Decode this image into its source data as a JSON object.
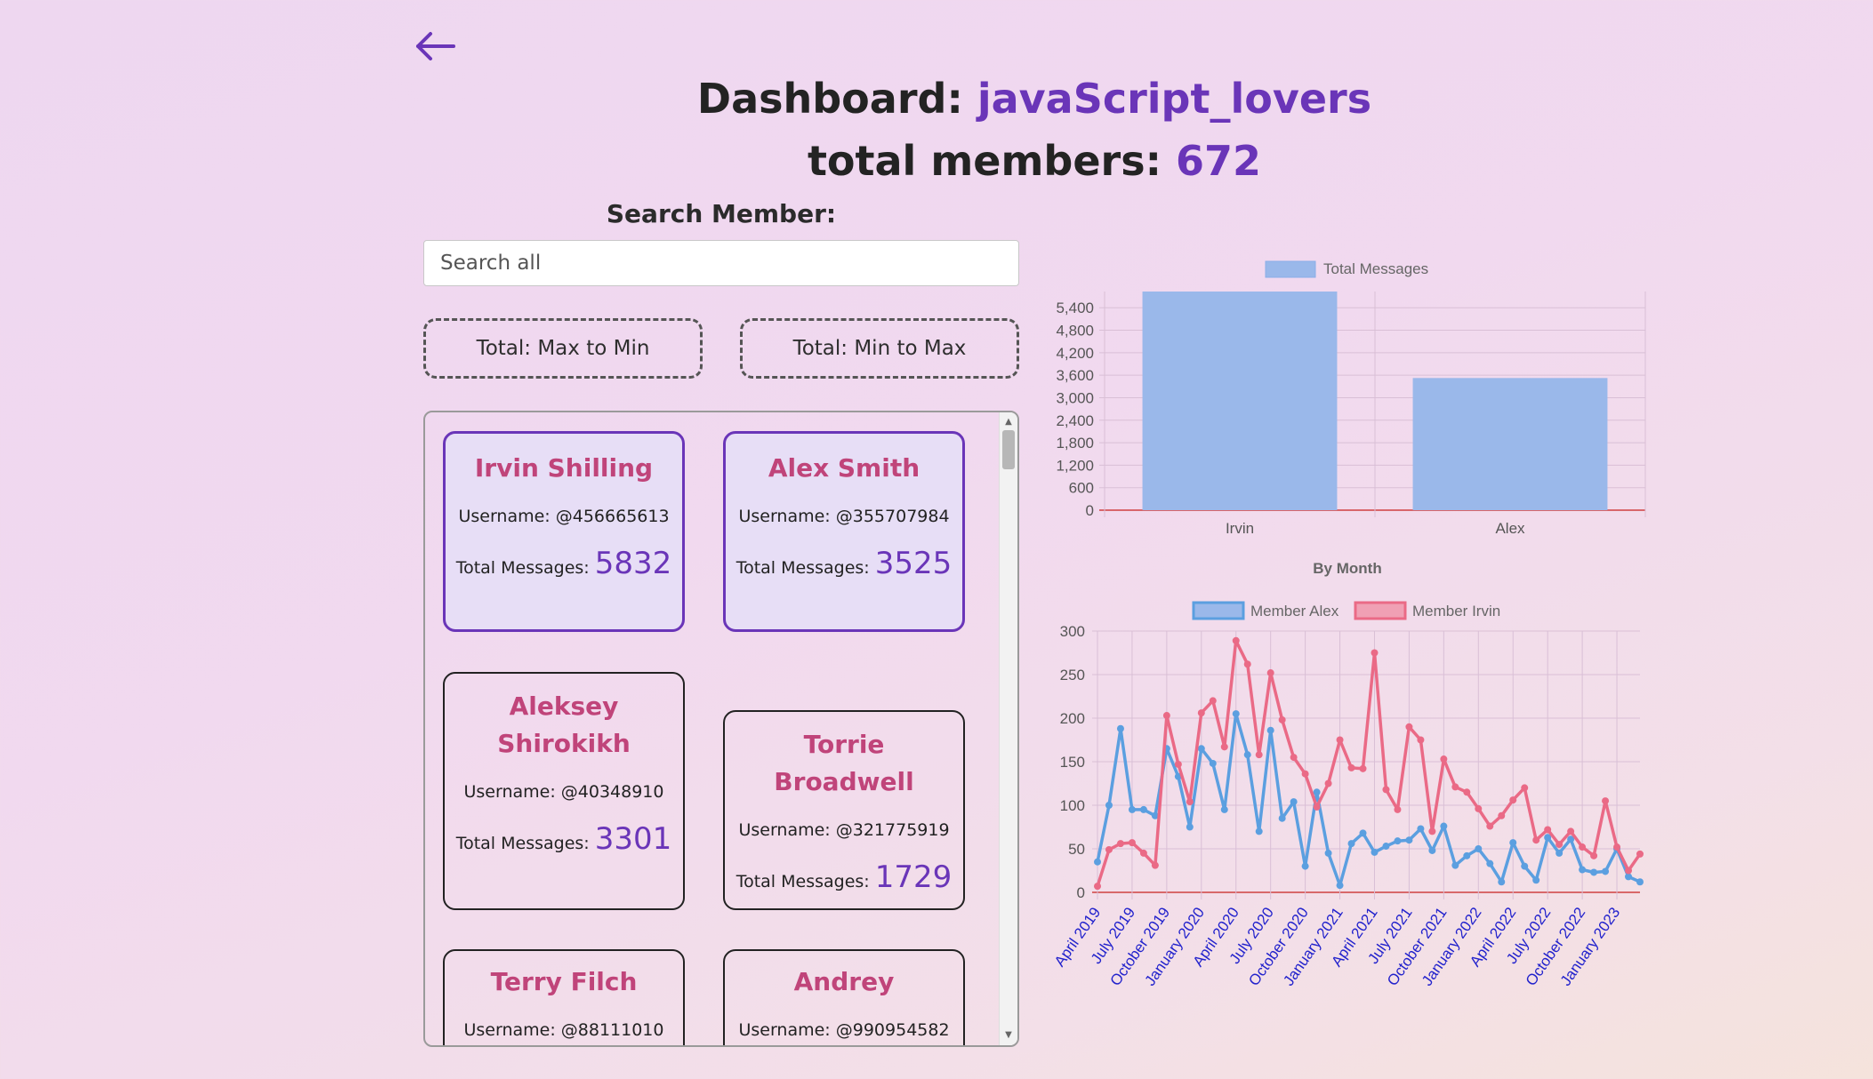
{
  "header": {
    "dashboard_prefix": "Dashboard:",
    "group_name": "javaScript_lovers",
    "members_prefix": "total members:",
    "members_count": "672"
  },
  "search": {
    "label": "Search Member:",
    "placeholder": "Search all",
    "value": ""
  },
  "sort": {
    "max_to_min": "Total: Max to Min",
    "min_to_max": "Total: Min to Max"
  },
  "members": [
    {
      "name": "Irvin Shilling",
      "username": "Username: @456665613",
      "total_label": "Total Messages:",
      "total": "5832",
      "selected": true
    },
    {
      "name": "Alex Smith",
      "username": "Username: @355707984",
      "total_label": "Total Messages:",
      "total": "3525",
      "selected": true
    },
    {
      "name": "Aleksey Shirokikh",
      "username": "Username: @40348910",
      "total_label": "Total Messages:",
      "total": "3301",
      "selected": false
    },
    {
      "name": "Torrie Broadwell",
      "username": "Username: @321775919",
      "total_label": "Total Messages:",
      "total": "1729",
      "selected": false
    },
    {
      "name": "Terry Filch",
      "username": "Username: @88111010",
      "total_label": "Total Messages:",
      "total": "",
      "selected": false
    },
    {
      "name": "Andrey",
      "username": "Username: @990954582",
      "total_label": "Total Messages:",
      "total": "",
      "selected": false
    }
  ],
  "colors": {
    "accent": "#6a35b8",
    "name": "#c0447a",
    "bar": "#9ab8ea",
    "alex": "#5b9fe0",
    "irvin": "#ea6a86"
  },
  "chart_data": [
    {
      "type": "bar",
      "legend": [
        "Total Messages"
      ],
      "categories": [
        "Irvin",
        "Alex"
      ],
      "values": [
        5832,
        3525
      ],
      "ylim": [
        0,
        5832
      ],
      "yticks": [
        "0",
        "600",
        "1,200",
        "1,800",
        "2,400",
        "3,000",
        "3,600",
        "4,200",
        "4,800",
        "5,400"
      ],
      "grid": true,
      "legend_position": "top"
    },
    {
      "type": "line",
      "title": "By Month",
      "legend_position": "top",
      "grid": true,
      "ylim": [
        0,
        300
      ],
      "yticks": [
        "0",
        "50",
        "100",
        "150",
        "200",
        "250",
        "300"
      ],
      "xtick_labels": [
        "April 2019",
        "July 2019",
        "October 2019",
        "January 2020",
        "April 2020",
        "July 2020",
        "October 2020",
        "January 2021",
        "April 2021",
        "July 2021",
        "October 2021",
        "January 2022",
        "April 2022",
        "July 2022",
        "October 2022",
        "January 2023"
      ],
      "series": [
        {
          "name": "Member Alex",
          "values": [
            35,
            100,
            188,
            95,
            95,
            88,
            165,
            133,
            75,
            165,
            148,
            95,
            205,
            158,
            70,
            186,
            85,
            104,
            30,
            115,
            45,
            8,
            56,
            68,
            46,
            53,
            59,
            60,
            73,
            48,
            76,
            31,
            42,
            50,
            33,
            12,
            57,
            30,
            14,
            63,
            45,
            61,
            26,
            23,
            24,
            50,
            18,
            12
          ]
        },
        {
          "name": "Member Irvin",
          "values": [
            7,
            49,
            56,
            57,
            45,
            31,
            203,
            147,
            104,
            206,
            220,
            167,
            289,
            262,
            158,
            252,
            198,
            155,
            136,
            98,
            125,
            175,
            143,
            142,
            275,
            118,
            95,
            190,
            175,
            70,
            153,
            121,
            115,
            96,
            76,
            88,
            106,
            120,
            60,
            72,
            55,
            70,
            52,
            42,
            105,
            52,
            25,
            44
          ]
        }
      ]
    }
  ]
}
